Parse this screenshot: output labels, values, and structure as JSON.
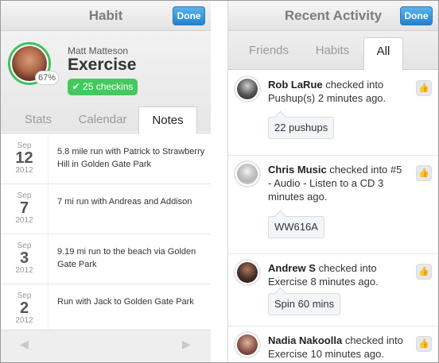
{
  "left": {
    "title": "Habit",
    "done_label": "Done",
    "user_name": "Matt Matteson",
    "habit_name": "Exercise",
    "progress_pct": "67%",
    "checkins_label": "25 checkins",
    "tabs": [
      "Stats",
      "Calendar",
      "Notes"
    ],
    "active_tab": "Notes",
    "notes": [
      {
        "month": "Sep",
        "day": "12",
        "year": "2012",
        "text": "5.8 mile run with Patrick to Strawberry Hill in Golden Gate Park"
      },
      {
        "month": "Sep",
        "day": "7",
        "year": "2012",
        "text": "7 mi run with Andreas and Addison"
      },
      {
        "month": "Sep",
        "day": "3",
        "year": "2012",
        "text": "9.19 mi run to the beach via Golden Gate Park"
      },
      {
        "month": "Sep",
        "day": "2",
        "year": "2012",
        "text": "Run with Jack to Golden Gate Park"
      }
    ],
    "pager": {
      "prev_icon": "chevron-left-icon",
      "next_icon": "chevron-right-icon"
    }
  },
  "right": {
    "title": "Recent Activity",
    "done_label": "Done",
    "tabs": [
      "Friends",
      "Habits",
      "All"
    ],
    "active_tab": "All",
    "activities": [
      {
        "name": "Rob LaRue",
        "text": " checked into Pushup(s) 2 minutes ago.",
        "detail": "22 pushups"
      },
      {
        "name": "Chris Music",
        "text": " checked into #5 - Audio - Listen to a CD 3 minutes ago.",
        "detail": "WW616A"
      },
      {
        "name": "Andrew S",
        "text": " checked into Exercise 8 minutes ago.",
        "detail": "Spin 60 mins"
      },
      {
        "name": "Nadia Nakoolla",
        "text": " checked into Exercise 10 minutes ago.",
        "detail": ""
      }
    ]
  },
  "colors": {
    "accent_blue": "#2382cf",
    "checkin_green": "#44c95e",
    "ring_green": "#3bc35a"
  }
}
